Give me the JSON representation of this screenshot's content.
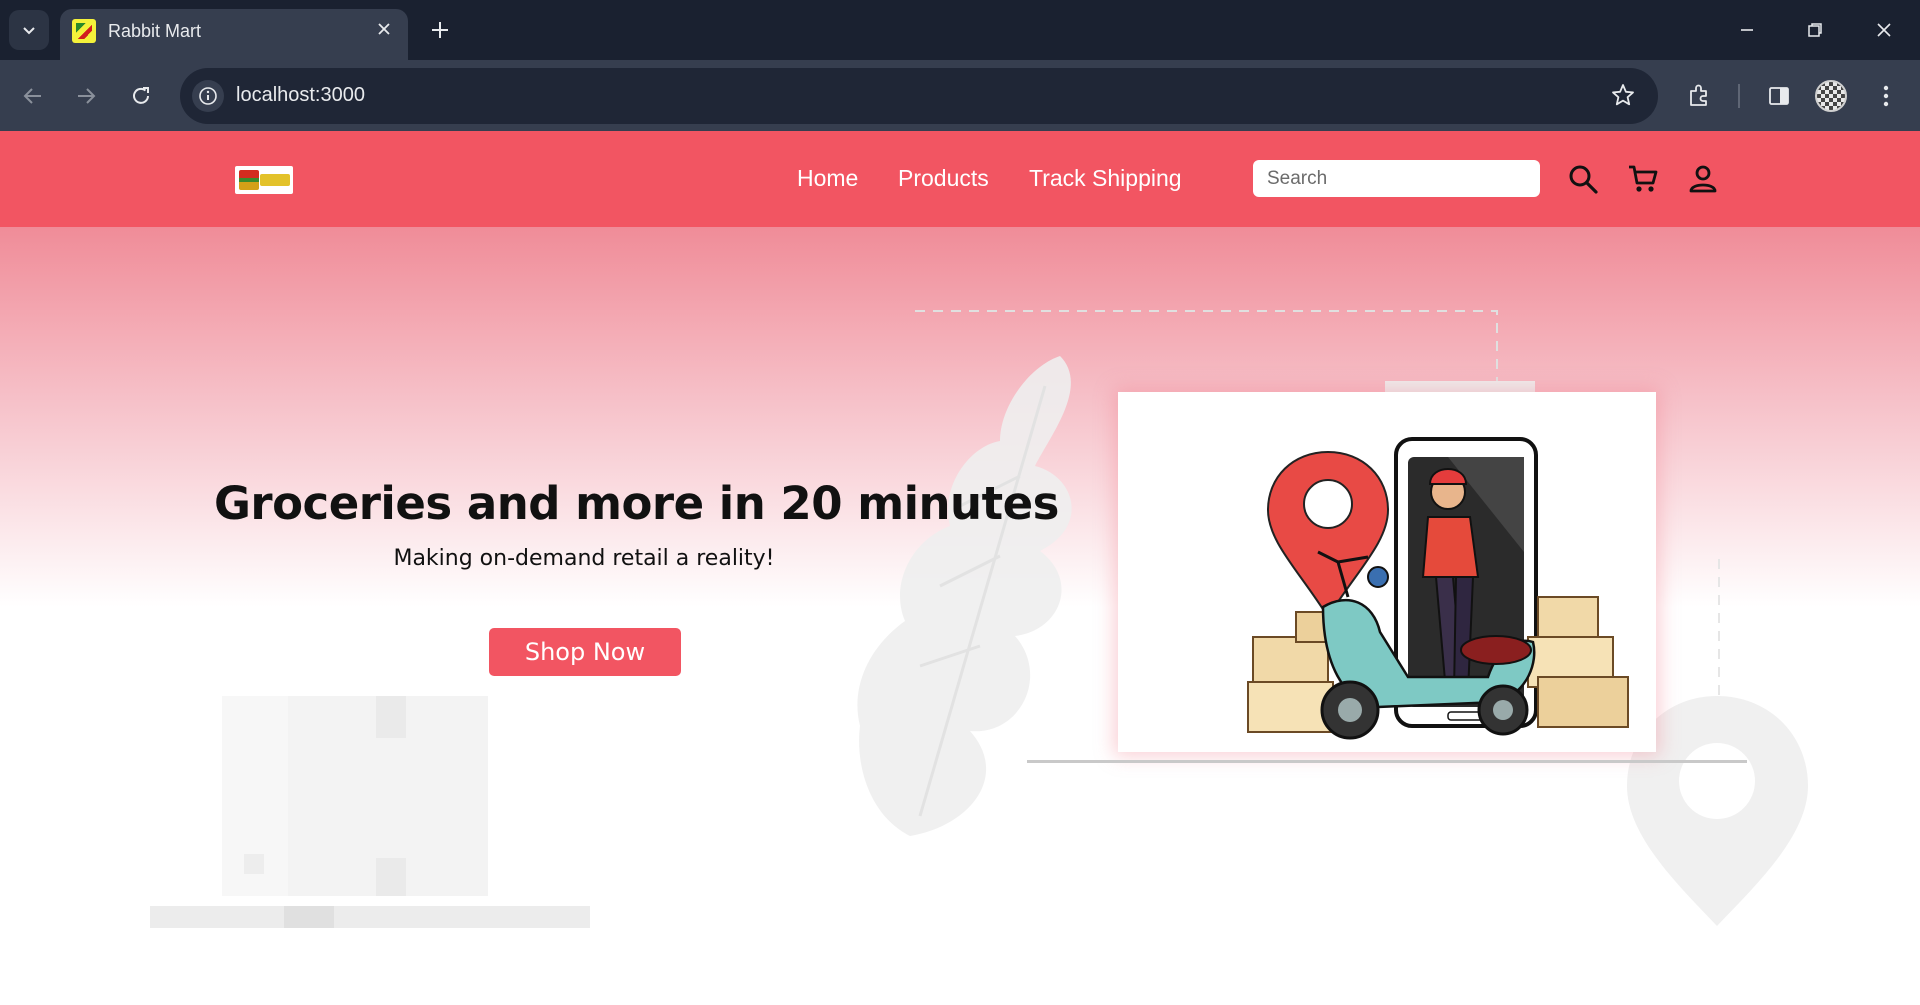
{
  "browser": {
    "tab_title": "Rabbit Mart",
    "url": "localhost:3000"
  },
  "site": {
    "nav": {
      "links": [
        "Home",
        "Products",
        "Track Shipping"
      ],
      "search_placeholder": "Search"
    },
    "hero": {
      "title": "Groceries and more in 20 minutes",
      "subtitle": "Making on-demand retail a reality!",
      "cta_label": "Shop Now"
    }
  },
  "colors": {
    "brand": "#f25562",
    "chrome_dark": "#1a2130",
    "chrome_toolbar": "#363e4f"
  },
  "icons": {
    "tab_search": "chevron-down-icon",
    "tab_close": "close-icon",
    "new_tab": "plus-icon",
    "window": [
      "minimize-icon",
      "restore-icon",
      "close-icon"
    ],
    "toolbar": [
      "back-icon",
      "forward-icon",
      "reload-icon",
      "info-icon",
      "star-icon",
      "extensions-icon",
      "side-panel-icon",
      "profile-icon",
      "more-icon"
    ],
    "site_nav": [
      "search-icon",
      "cart-icon",
      "account-icon"
    ]
  }
}
